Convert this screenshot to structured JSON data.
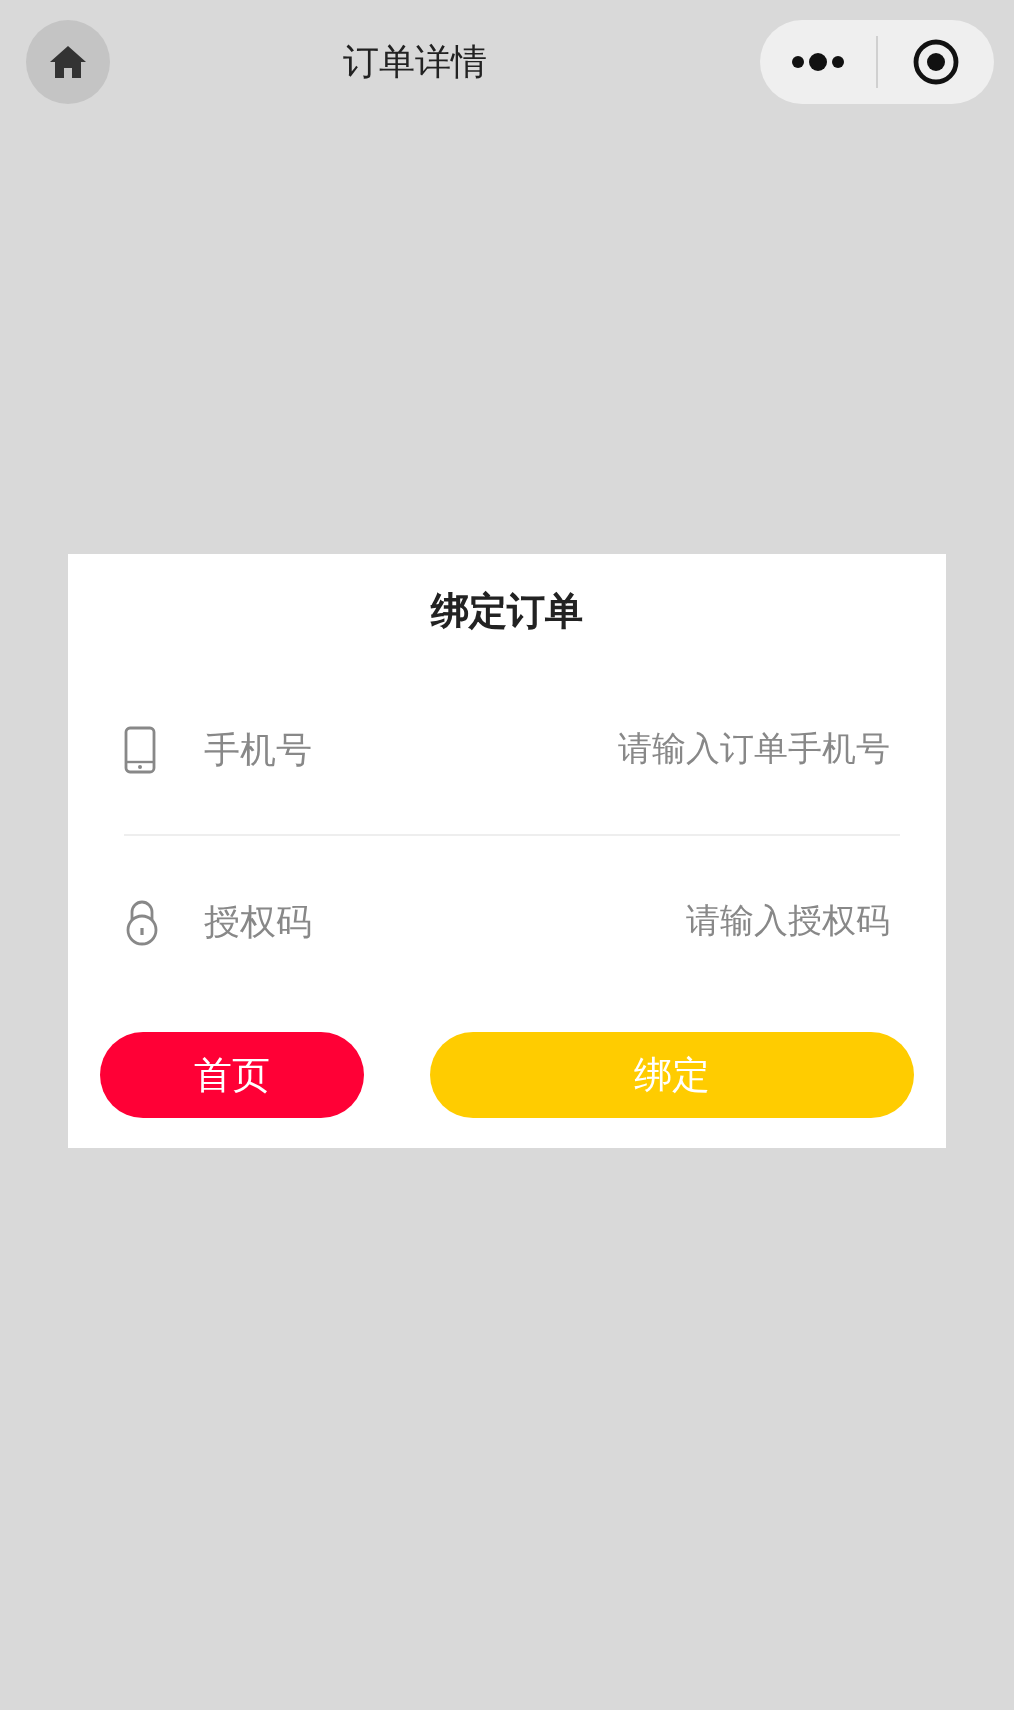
{
  "nav_bar": {
    "title": "订单详情"
  },
  "dialog": {
    "title": "绑定订单",
    "fields": [
      {
        "kind": "phone",
        "label": "手机号",
        "placeholder": "请输入订单手机号"
      },
      {
        "kind": "lock",
        "label": "授权码",
        "placeholder": "请输入授权码"
      }
    ],
    "buttons": [
      {
        "kind": "secondary",
        "label": "首页"
      },
      {
        "kind": "primary",
        "label": "绑定"
      }
    ]
  }
}
